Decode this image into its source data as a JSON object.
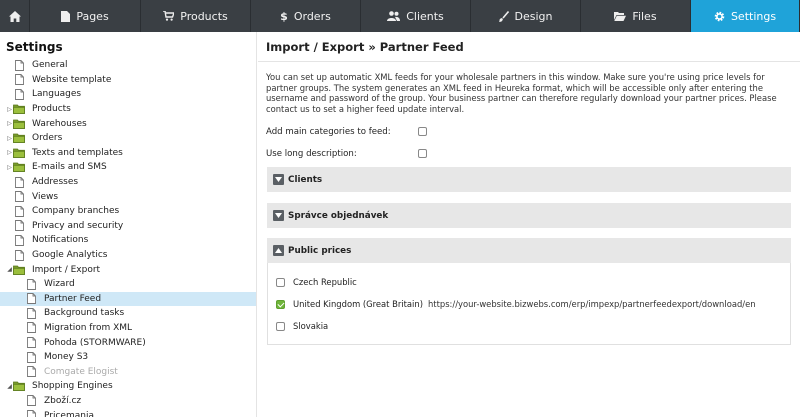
{
  "nav": {
    "tabs": [
      {
        "label": "Pages",
        "icon": "document-icon"
      },
      {
        "label": "Products",
        "icon": "cart-icon"
      },
      {
        "label": "Orders",
        "icon": "dollar-icon"
      },
      {
        "label": "Clients",
        "icon": "users-icon"
      },
      {
        "label": "Design",
        "icon": "brush-icon"
      },
      {
        "label": "Files",
        "icon": "folder-open-icon"
      },
      {
        "label": "Settings",
        "icon": "gear-icon",
        "active": true
      }
    ],
    "active_color": "#1fa3d9",
    "bar_color": "#3a3f44"
  },
  "sidebar": {
    "title": "Settings",
    "items": [
      {
        "label": "General",
        "type": "page",
        "level": 0
      },
      {
        "label": "Website template",
        "type": "page",
        "level": 0
      },
      {
        "label": "Languages",
        "type": "page",
        "level": 0
      },
      {
        "label": "Products",
        "type": "folder",
        "level": 0,
        "state": "collapsed"
      },
      {
        "label": "Warehouses",
        "type": "folder",
        "level": 0,
        "state": "collapsed"
      },
      {
        "label": "Orders",
        "type": "folder",
        "level": 0,
        "state": "collapsed"
      },
      {
        "label": "Texts and templates",
        "type": "folder",
        "level": 0,
        "state": "collapsed"
      },
      {
        "label": "E-mails and SMS",
        "type": "folder",
        "level": 0,
        "state": "collapsed"
      },
      {
        "label": "Addresses",
        "type": "page",
        "level": 0
      },
      {
        "label": "Views",
        "type": "page",
        "level": 0
      },
      {
        "label": "Company branches",
        "type": "page",
        "level": 0
      },
      {
        "label": "Privacy and security",
        "type": "page",
        "level": 0
      },
      {
        "label": "Notifications",
        "type": "page",
        "level": 0
      },
      {
        "label": "Google Analytics",
        "type": "page",
        "level": 0
      },
      {
        "label": "Import / Export",
        "type": "folder",
        "level": 0,
        "state": "expanded"
      },
      {
        "label": "Wizard",
        "type": "page",
        "level": 1
      },
      {
        "label": "Partner Feed",
        "type": "page",
        "level": 1,
        "selected": true
      },
      {
        "label": "Background tasks",
        "type": "page",
        "level": 1
      },
      {
        "label": "Migration from XML",
        "type": "page",
        "level": 1
      },
      {
        "label": "Pohoda (STORMWARE)",
        "type": "page",
        "level": 1
      },
      {
        "label": "Money S3",
        "type": "page",
        "level": 1
      },
      {
        "label": "Comgate Elogist",
        "type": "page",
        "level": 1,
        "disabled": true
      },
      {
        "label": "Shopping Engines",
        "type": "folder",
        "level": 0,
        "state": "expanded"
      },
      {
        "label": "Zboží.cz",
        "type": "page",
        "level": 1
      },
      {
        "label": "Pricemania",
        "type": "page",
        "level": 1
      }
    ]
  },
  "main": {
    "title": "Import / Export » Partner Feed",
    "description": "You can set up automatic XML feeds for your wholesale partners in this window. Make sure you're using price levels for partner groups. The system generates an XML feed in Heureka format, which will be accessible only after entering the username and password of the group. Your business partner can therefore regularly download your partner prices. Please contact us to set a higher feed update interval.",
    "options": [
      {
        "label": "Add main categories to feed:",
        "checked": false
      },
      {
        "label": "Use long description:",
        "checked": false
      }
    ],
    "sections": [
      {
        "title": "Clients",
        "expanded": false
      },
      {
        "title": "Správce objednávek",
        "expanded": false
      },
      {
        "title": "Public prices",
        "expanded": true
      }
    ],
    "public_prices": [
      {
        "name": "Czech Republic",
        "checked": false,
        "url": ""
      },
      {
        "name": "United Kingdom (Great Britain)",
        "checked": true,
        "url": "https://your-website.bizwebs.com/erp/impexp/partnerfeedexport/download/en"
      },
      {
        "name": "Slovakia",
        "checked": false,
        "url": ""
      }
    ]
  }
}
